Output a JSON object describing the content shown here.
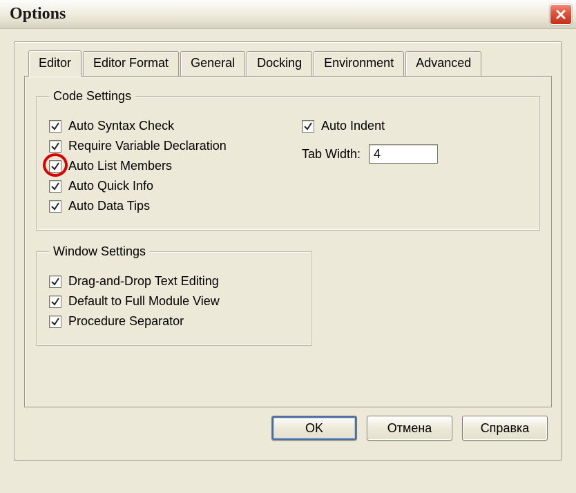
{
  "window": {
    "title": "Options"
  },
  "tabs": {
    "editor": "Editor",
    "editor_format": "Editor Format",
    "general": "General",
    "docking": "Docking",
    "environment": "Environment",
    "advanced": "Advanced"
  },
  "groups": {
    "code_settings": {
      "legend": "Code Settings",
      "auto_syntax_check": "Auto Syntax Check",
      "require_var_decl": "Require Variable Declaration",
      "auto_list_members": "Auto List Members",
      "auto_quick_info": "Auto Quick Info",
      "auto_data_tips": "Auto Data Tips",
      "auto_indent": "Auto Indent",
      "tab_width_label": "Tab Width:",
      "tab_width_value": "4"
    },
    "window_settings": {
      "legend": "Window Settings",
      "drag_drop": "Drag-and-Drop Text Editing",
      "full_module": "Default to Full Module View",
      "proc_sep": "Procedure Separator"
    }
  },
  "buttons": {
    "ok": "OK",
    "cancel": "Отмена",
    "help": "Справка"
  }
}
